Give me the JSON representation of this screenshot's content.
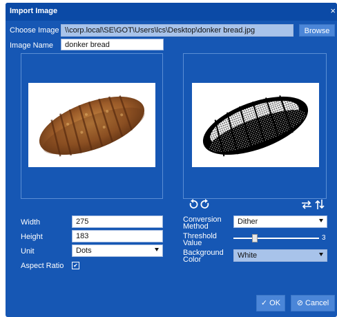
{
  "dialog": {
    "title": "Import Image",
    "close_symbol": "×"
  },
  "choose": {
    "label": "Choose Image",
    "path": "\\\\corp.local\\SE\\GOT\\Users\\lcs\\Desktop\\donker bread.jpg",
    "browse": "Browse"
  },
  "name": {
    "label": "Image Name",
    "value": "donker bread"
  },
  "width": {
    "label": "Width",
    "value": "275"
  },
  "height": {
    "label": "Height",
    "value": "183"
  },
  "unit": {
    "label": "Unit",
    "value": "Dots"
  },
  "aspect": {
    "label": "Aspect Ratio",
    "checked": true,
    "check_symbol": "✔"
  },
  "conversion": {
    "label": "Conversion Method",
    "value": "Dither"
  },
  "threshold": {
    "label": "Threshold Value",
    "value": "3"
  },
  "background": {
    "label": "Background Color",
    "value": "White"
  },
  "footer": {
    "ok": "✓ OK",
    "cancel": "⊘ Cancel"
  },
  "icons": {
    "rotate_left": "rotate-left-icon",
    "rotate_right": "rotate-right-icon",
    "flip_horizontal": "flip-horizontal-icon",
    "flip_vertical": "flip-vertical-icon"
  },
  "colors": {
    "dialog_bg": "#1657b4",
    "titlebar": "#0b4aa6",
    "button": "#4b86d8",
    "path_field": "#a8c3ea"
  }
}
